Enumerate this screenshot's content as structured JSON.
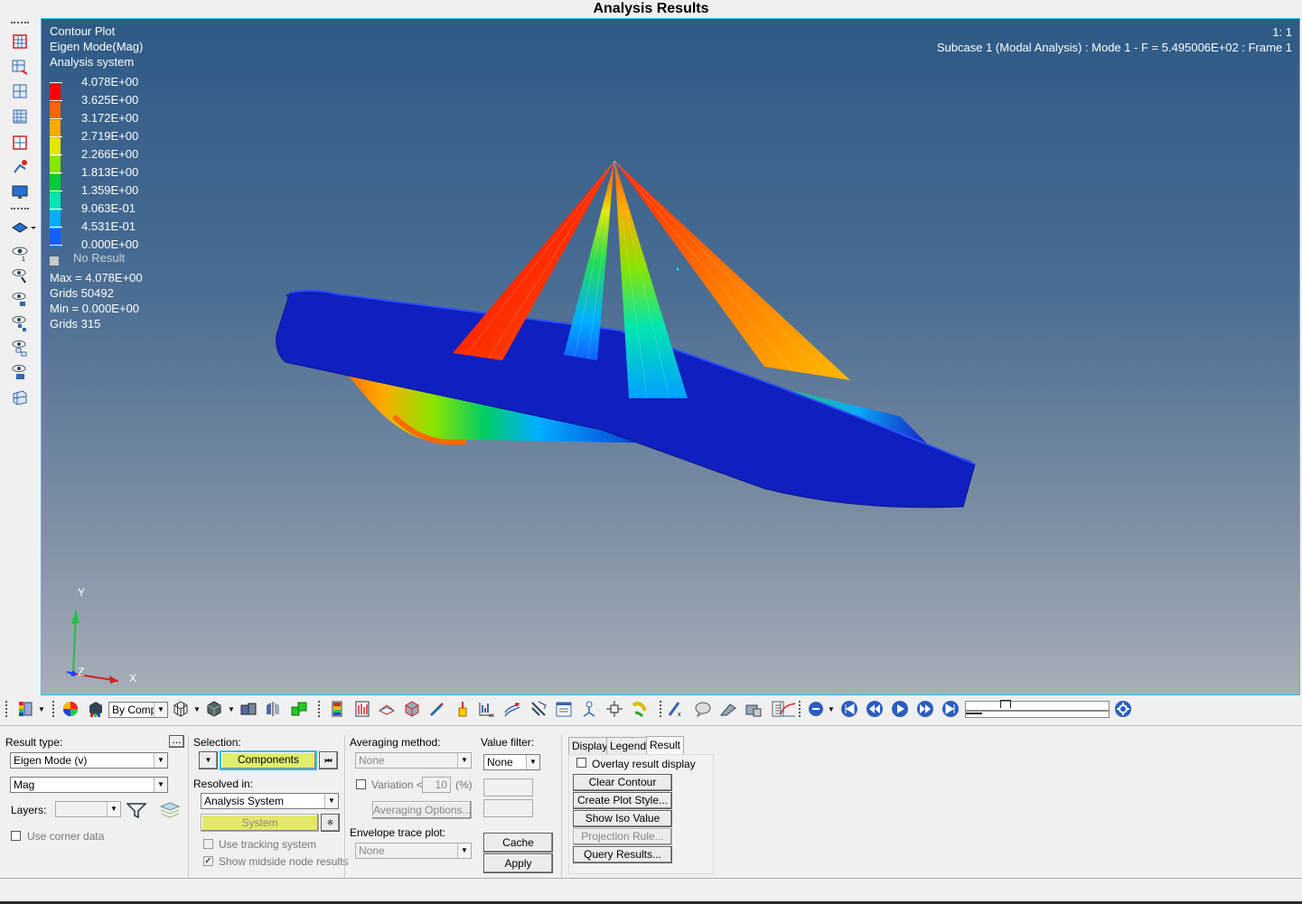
{
  "title": "Analysis Results",
  "viewport": {
    "plot_type": "Contour Plot",
    "result_label": "Eigen Mode(Mag)",
    "system_label": "Analysis system",
    "zoom": "1: 1",
    "subcase": "Subcase 1 (Modal Analysis) : Mode 1 - F = 5.495006E+02 : Frame 1",
    "legend": [
      {
        "label": "4.078E+00",
        "color": "#ff0000"
      },
      {
        "label": "3.625E+00",
        "color": "#ff6600"
      },
      {
        "label": "3.172E+00",
        "color": "#ffaa00"
      },
      {
        "label": "2.719E+00",
        "color": "#e5e500"
      },
      {
        "label": "2.266E+00",
        "color": "#88e500"
      },
      {
        "label": "1.813E+00",
        "color": "#00cc33"
      },
      {
        "label": "1.359E+00",
        "color": "#00e5b0"
      },
      {
        "label": "9.063E-01",
        "color": "#00b0ff"
      },
      {
        "label": "4.531E-01",
        "color": "#1060ff"
      },
      {
        "label": "0.000E+00",
        "color": "#0000c8"
      }
    ],
    "no_result": "No Result",
    "max_label": "Max =  4.078E+00",
    "max_grids": "Grids 50492",
    "min_label": "Min =  0.000E+00",
    "min_grids": "Grids 315",
    "axes": {
      "x": "X",
      "y": "Y",
      "z": "Z"
    }
  },
  "toolbar": {
    "by_comp": "By Comp"
  },
  "panel": {
    "result_type_label": "Result type:",
    "more_btn": "...",
    "result_type_value": "Eigen Mode (v)",
    "component_value": "Mag",
    "layers_label": "Layers:",
    "use_corner_data": "Use corner data",
    "selection_label": "Selection:",
    "components_btn": "Components",
    "resolved_in_label": "Resolved in:",
    "resolved_value": "Analysis System",
    "system_btn": "System",
    "use_tracking": "Use tracking system",
    "show_midside": "Show midside node results",
    "averaging_label": "Averaging method:",
    "averaging_value": "None",
    "variation_label": "Variation <",
    "variation_value": "10",
    "percent": "(%)",
    "averaging_options": "Averaging Options...",
    "envelope_label": "Envelope trace plot:",
    "envelope_value": "None",
    "value_filter_label": "Value filter:",
    "value_filter_value": "None",
    "cache_btn": "Cache",
    "apply_btn": "Apply",
    "tabs": [
      "Display",
      "Legend",
      "Result"
    ],
    "overlay": "Overlay result display",
    "clear_contour": "Clear Contour",
    "create_plot_style": "Create Plot Style...",
    "show_iso_value": "Show Iso Value",
    "projection_rule": "Projection Rule...",
    "query_results": "Query Results..."
  }
}
